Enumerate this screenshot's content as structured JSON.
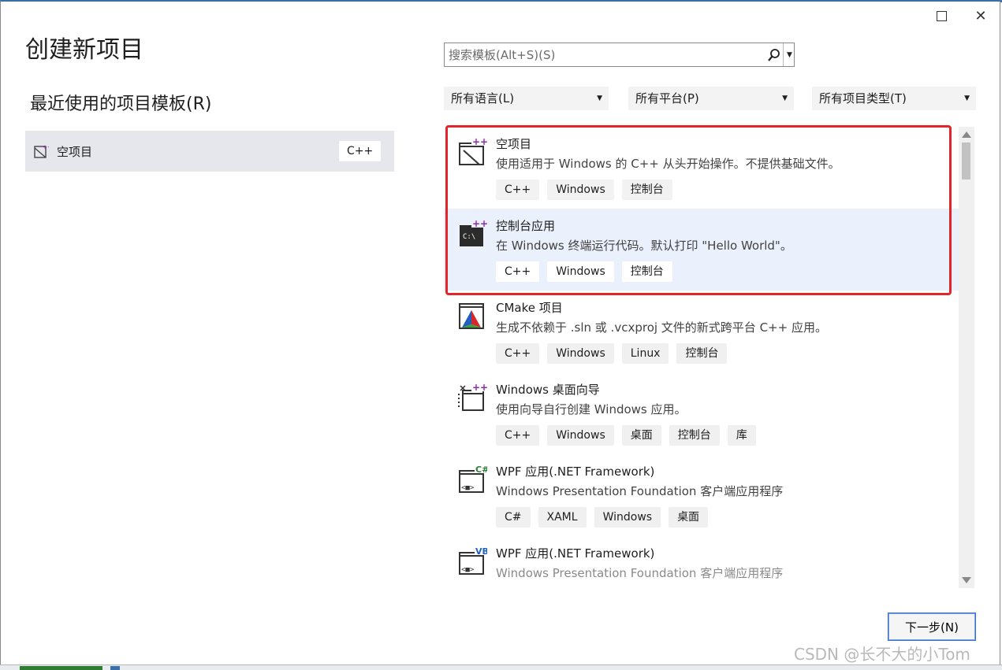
{
  "window": {
    "maximize": "□",
    "close": "✕"
  },
  "header": {
    "title": "创建新项目",
    "recent_heading": "最近使用的项目模板(R)"
  },
  "recent": [
    {
      "name": "空项目",
      "tag": "C++"
    }
  ],
  "search": {
    "placeholder": "搜索模板(Alt+S)(S)"
  },
  "filters": {
    "language": "所有语言(L)",
    "platform": "所有平台(P)",
    "project_type": "所有项目类型(T)"
  },
  "templates": [
    {
      "name": "空项目",
      "desc": "使用适用于 Windows 的 C++ 从头开始操作。不提供基础文件。",
      "tags": [
        "C++",
        "Windows",
        "控制台"
      ]
    },
    {
      "name": "控制台应用",
      "desc": "在 Windows 终端运行代码。默认打印 \"Hello World\"。",
      "tags": [
        "C++",
        "Windows",
        "控制台"
      ]
    },
    {
      "name": "CMake 项目",
      "desc": "生成不依赖于 .sln 或 .vcxproj 文件的新式跨平台 C++ 应用。",
      "tags": [
        "C++",
        "Windows",
        "Linux",
        "控制台"
      ]
    },
    {
      "name": "Windows 桌面向导",
      "desc": "使用向导自行创建 Windows 应用。",
      "tags": [
        "C++",
        "Windows",
        "桌面",
        "控制台",
        "库"
      ]
    },
    {
      "name": "WPF 应用(.NET Framework)",
      "desc": "Windows Presentation Foundation 客户端应用程序",
      "tags": [
        "C#",
        "XAML",
        "Windows",
        "桌面"
      ]
    },
    {
      "name": "WPF 应用(.NET Framework)",
      "desc": "Windows Presentation Foundation 客户端应用程序",
      "tags": []
    }
  ],
  "footer": {
    "next": "下一步(N)"
  },
  "watermark": "CSDN @长不大的小Tom",
  "colors": {
    "highlight": "#eaf0fc",
    "annotation_red": "#e3242b",
    "accent": "#3c6fc4"
  }
}
